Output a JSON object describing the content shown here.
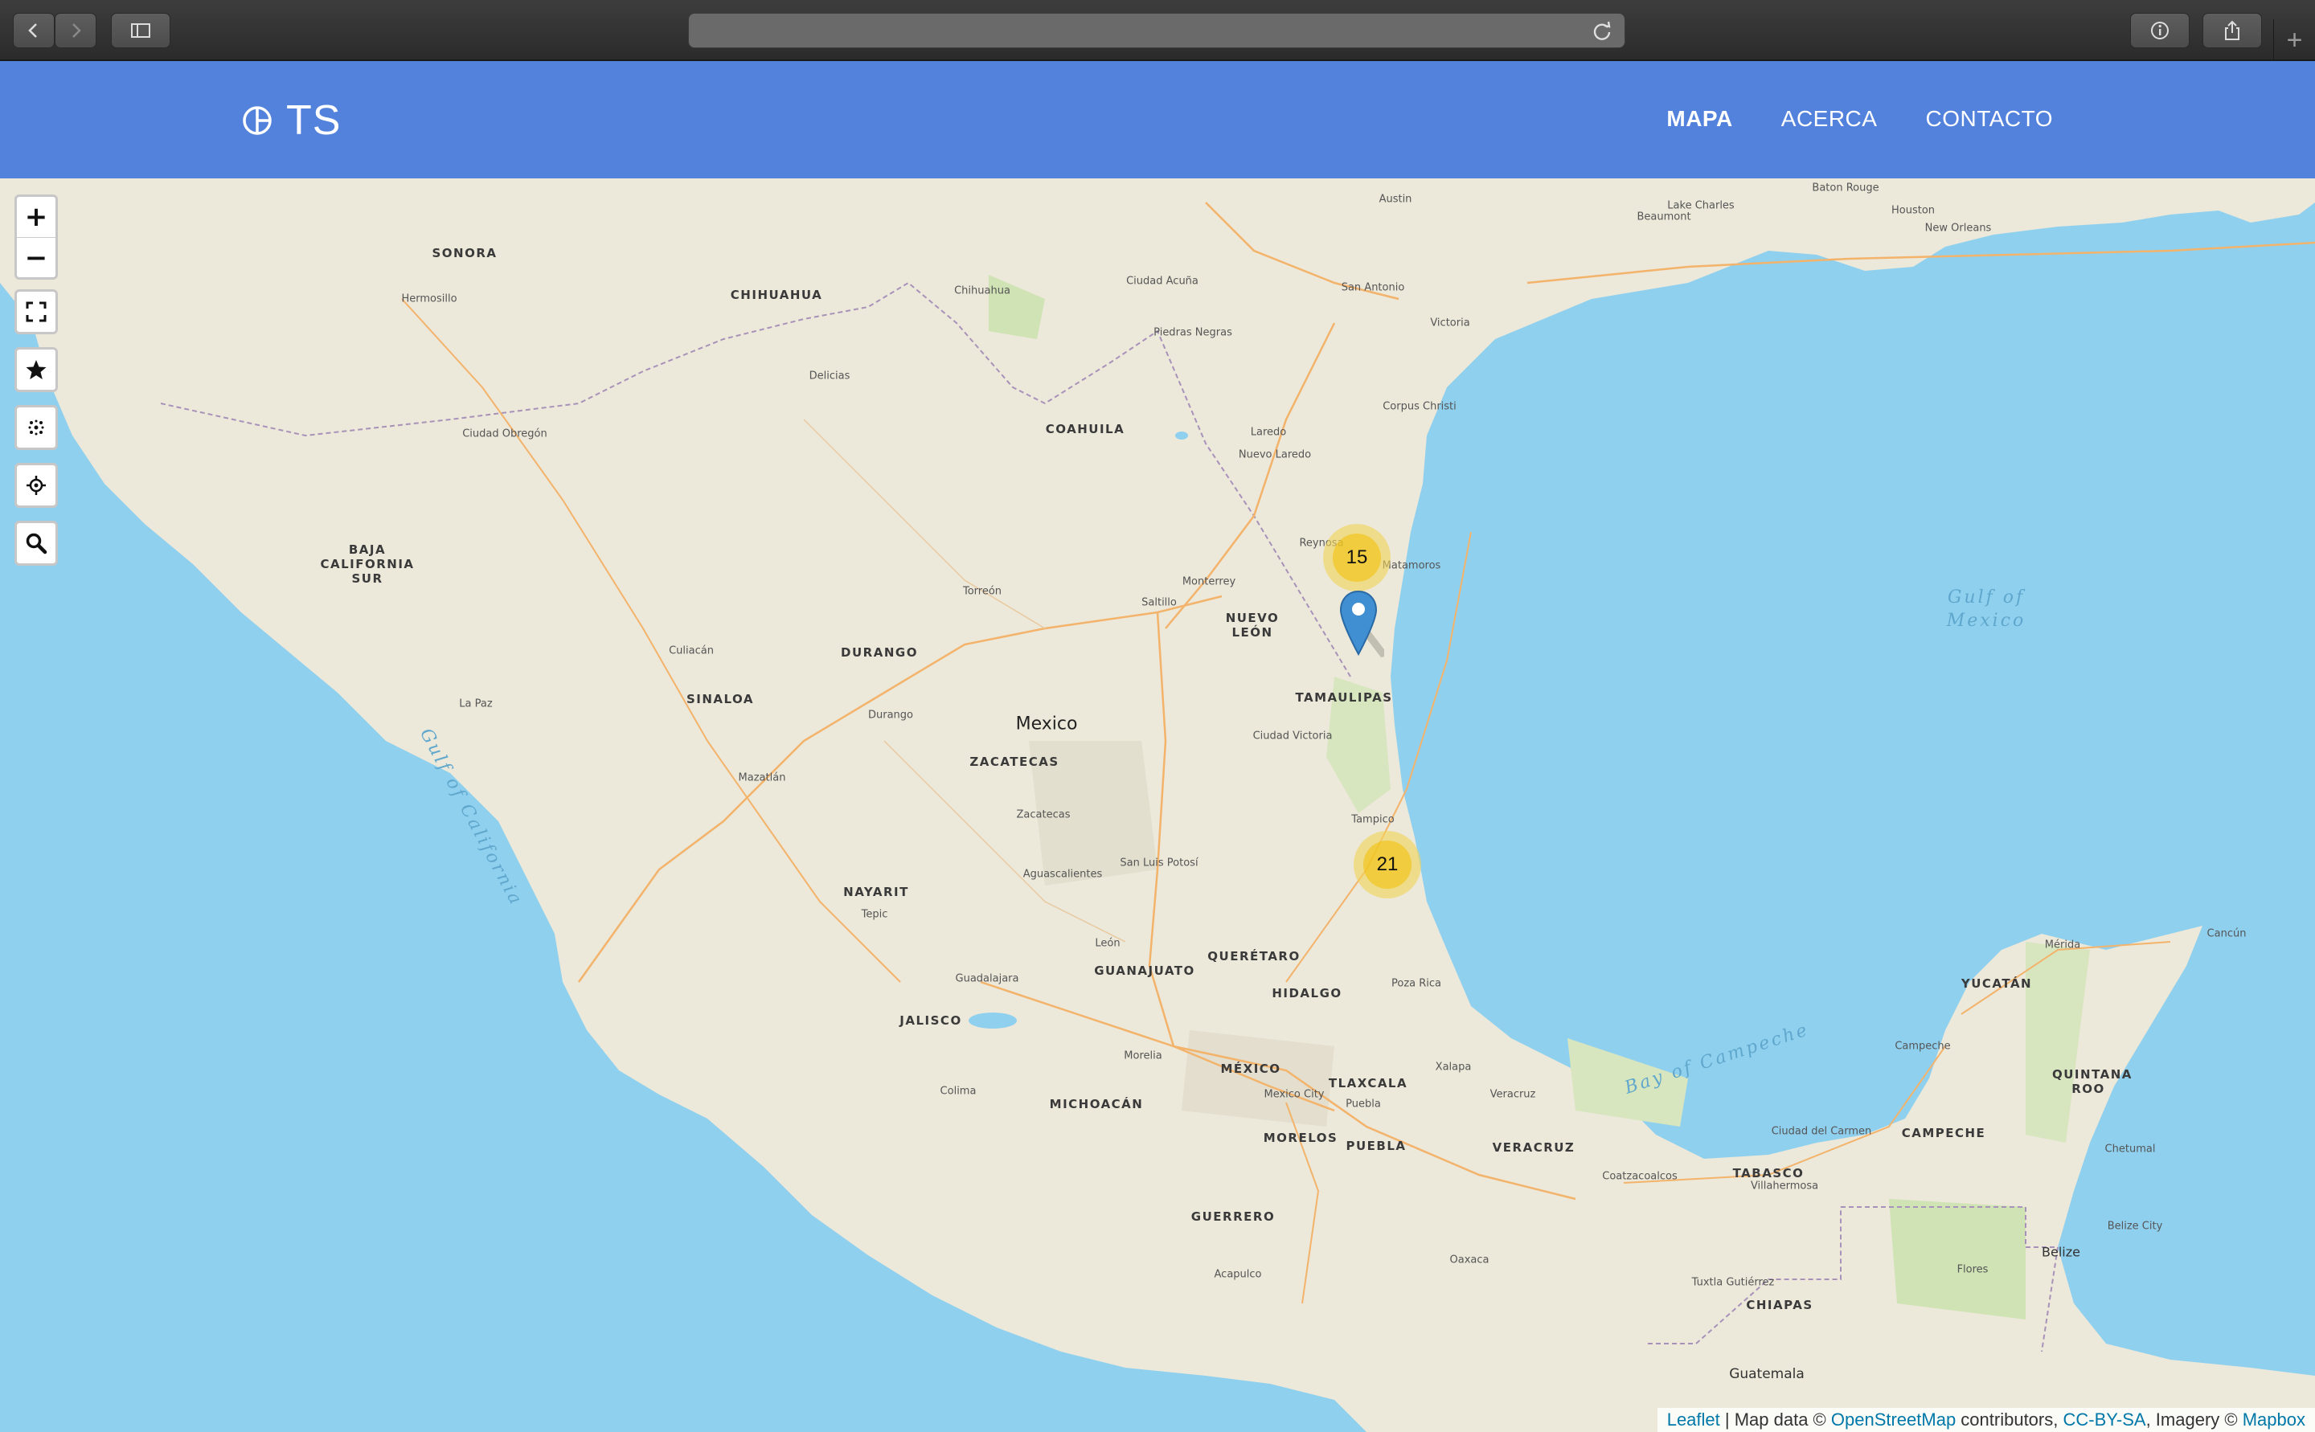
{
  "browser": {
    "back_icon": "chevron-left-icon",
    "forward_icon": "chevron-right-icon",
    "sidebar_icon": "sidebar-icon",
    "reload_icon": "reload-icon",
    "info_icon": "info-icon",
    "share_icon": "share-icon",
    "new_tab_label": "+"
  },
  "navbar": {
    "brand": "TS",
    "brand_icon": "circle-quadrant-icon",
    "links": [
      {
        "label": "MAPA",
        "active": true
      },
      {
        "label": "ACERCA",
        "active": false
      },
      {
        "label": "CONTACTO",
        "active": false
      }
    ],
    "color": "#5382dd"
  },
  "map_controls": {
    "zoom_in": "+",
    "zoom_out": "−",
    "fullscreen_icon": "fullscreen-icon",
    "favorites_icon": "star-icon",
    "cluster_toggle_icon": "cluster-icon",
    "locate_icon": "crosshair-icon",
    "search_icon": "search-icon"
  },
  "map_labels": {
    "country": "Mexico",
    "states": [
      "SONORA",
      "CHIHUAHUA",
      "COAHUILA",
      "BAJA CALIFORNIA SUR",
      "DURANGO",
      "SINALOA",
      "NUEVO LEÓN",
      "TAMAULIPAS",
      "ZACATECAS",
      "NAYARIT",
      "GUANAJUATO",
      "QUERÉTARO",
      "HIDALGO",
      "JALISCO",
      "MÉXICO",
      "TLAXCALA",
      "MICHOACÁN",
      "MORELOS",
      "PUEBLA",
      "VERACRUZ",
      "GUERRERO",
      "TABASCO",
      "CAMPECHE",
      "YUCATÁN",
      "QUINTANA ROO",
      "CHIAPAS"
    ],
    "cities": [
      "Austin",
      "San Antonio",
      "Corpus Christi",
      "Houston",
      "New Orleans",
      "Baton Rouge",
      "Lake Charles",
      "Beaumont",
      "Victoria",
      "Laredo",
      "Monterrey",
      "Saltillo",
      "Torreón",
      "Hermosillo",
      "Ciudad Obregón",
      "Culiacán",
      "Mazatlán",
      "Durango",
      "Zacatecas",
      "Aguascalientes",
      "San Luis Potosí",
      "León",
      "Guadalajara",
      "Morelia",
      "Mexico City",
      "Puebla",
      "Veracruz",
      "Xalapa",
      "Tampico",
      "Ciudad Victoria",
      "Matamoros",
      "Oaxaca",
      "Acapulco",
      "Mérida",
      "Campeche",
      "Villahermosa",
      "Cancún",
      "Tuxtla Gutiérrez",
      "Guatemala",
      "Belize",
      "Tepic",
      "Colima",
      "La Paz",
      "Chihuahua",
      "Delicias",
      "Piedras Negras",
      "Ciudad Acuña",
      "Nuevo Laredo",
      "Reynosa",
      "Poza Rica",
      "Chetumal",
      "Belize City",
      "Flores",
      "Coatzacoalcos",
      "Ciudad del Carmen"
    ],
    "water": [
      "Gulf of California",
      "Gulf of Mexico",
      "Bay of Campeche"
    ]
  },
  "clusters": [
    {
      "count": "15"
    },
    {
      "count": "21"
    }
  ],
  "attribution": {
    "leaflet": "Leaflet",
    "sep1": " | Map data © ",
    "osm": "OpenStreetMap",
    "sep2": " contributors, ",
    "license": "CC-BY-SA",
    "sep3": ", Imagery © ",
    "mapbox": "Mapbox"
  }
}
